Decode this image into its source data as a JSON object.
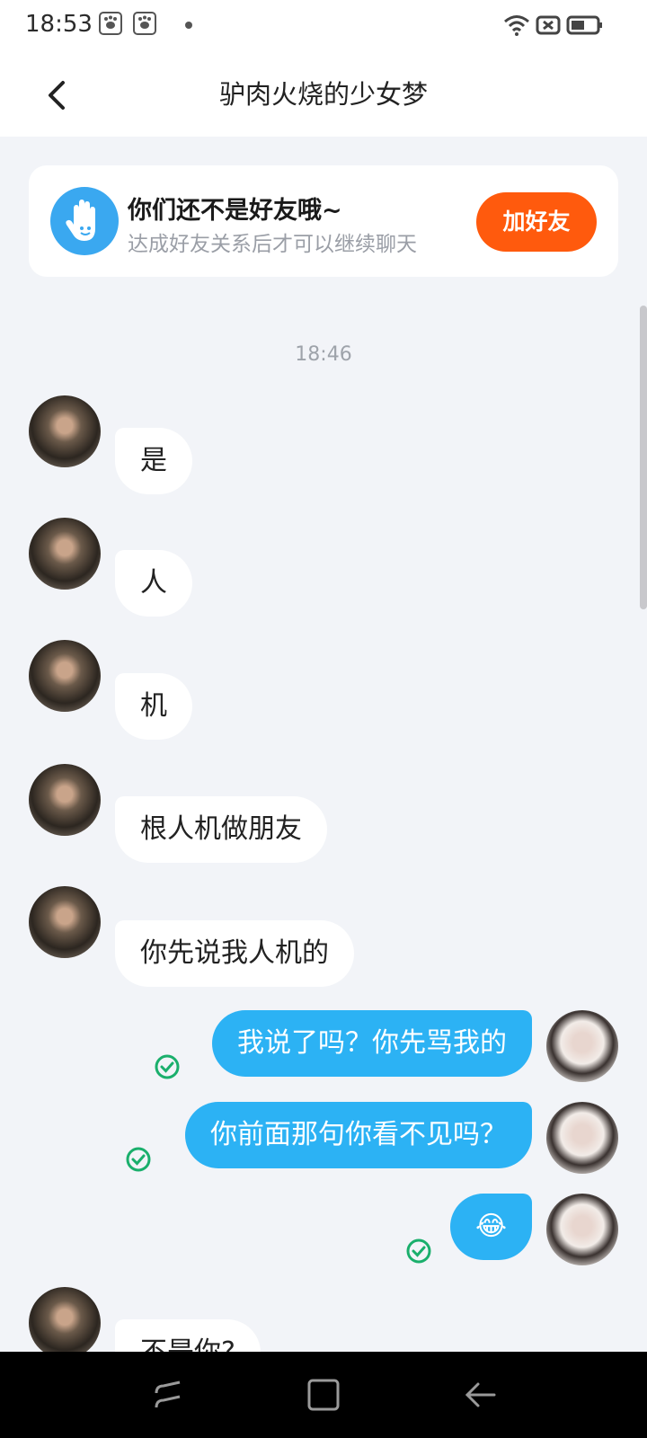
{
  "status_bar": {
    "time": "18:53",
    "icons": [
      "baidu-paw-icon",
      "baidu-paw-icon",
      "dot",
      "wifi-icon",
      "no-sim-icon",
      "battery-icon"
    ]
  },
  "header": {
    "title": "驴肉火烧的少女梦",
    "back_icon": "chevron-left-icon"
  },
  "friend_banner": {
    "title": "你们还不是好友哦~",
    "subtitle": "达成好友关系后才可以继续聊天",
    "button_label": "加好友",
    "button_color": "#ff5a0d"
  },
  "chat": {
    "timestamp": "18:46",
    "messages": [
      {
        "side": "left",
        "text": "是"
      },
      {
        "side": "left",
        "text": "人"
      },
      {
        "side": "left",
        "text": "机"
      },
      {
        "side": "left",
        "text": "根人机做朋友"
      },
      {
        "side": "left",
        "text": "你先说我人机的"
      },
      {
        "side": "right",
        "text": "我说了吗？你先骂我的",
        "read": true
      },
      {
        "side": "right",
        "text": "你前面那句你看不见吗？",
        "read": true
      },
      {
        "side": "right",
        "text": "😂",
        "read": true
      },
      {
        "side": "left",
        "text": "不是你?"
      }
    ],
    "sent_bubble_color": "#2cb2f4",
    "read_check_color": "#1aaf6c"
  },
  "nav_bar": {
    "icons": [
      "recent-apps-icon",
      "home-icon",
      "back-arrow-icon"
    ]
  }
}
